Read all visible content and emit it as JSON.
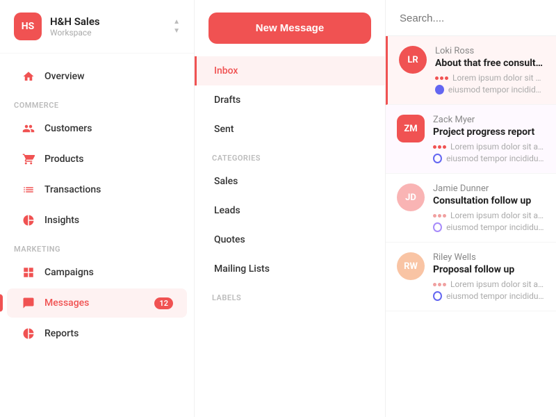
{
  "workspace": {
    "initials": "HS",
    "name": "H&H Sales",
    "subtitle": "Workspace"
  },
  "sidebar": {
    "overview_label": "Overview",
    "section_commerce": "Commerce",
    "section_marketing": "Marketing",
    "items": [
      {
        "id": "overview",
        "label": "Overview",
        "icon": "home",
        "active": false
      },
      {
        "id": "customers",
        "label": "Customers",
        "icon": "users",
        "active": false
      },
      {
        "id": "products",
        "label": "Products",
        "icon": "cart",
        "active": false
      },
      {
        "id": "transactions",
        "label": "Transactions",
        "icon": "list",
        "active": false
      },
      {
        "id": "insights",
        "label": "Insights",
        "icon": "pie",
        "active": false
      },
      {
        "id": "campaigns",
        "label": "Campaigns",
        "icon": "grid",
        "active": false
      },
      {
        "id": "messages",
        "label": "Messages",
        "icon": "chat",
        "active": true,
        "badge": "12"
      },
      {
        "id": "reports",
        "label": "Reports",
        "icon": "pie",
        "active": false
      }
    ]
  },
  "middle": {
    "new_message_label": "New Message",
    "nav_items": [
      {
        "id": "inbox",
        "label": "Inbox",
        "active": true
      },
      {
        "id": "drafts",
        "label": "Drafts",
        "active": false
      },
      {
        "id": "sent",
        "label": "Sent",
        "active": false
      }
    ],
    "section_categories": "Categories",
    "categories": [
      {
        "id": "sales",
        "label": "Sales"
      },
      {
        "id": "leads",
        "label": "Leads"
      },
      {
        "id": "quotes",
        "label": "Quotes"
      },
      {
        "id": "mailing-lists",
        "label": "Mailing Lists"
      }
    ],
    "section_labels": "Labels"
  },
  "right": {
    "search_placeholder": "Search....",
    "messages": [
      {
        "id": "msg1",
        "avatar_initials": "LR",
        "avatar_class": "avatar-lr",
        "sender": "Loki Ross",
        "subject": "About that free consultatio",
        "preview": "Lorem ipsum dolor sit amet, co",
        "preview2": "eiusmod tempor incididunt ut",
        "selected": true,
        "dots": [
          "#f05252",
          "#f05252",
          "#f05252"
        ],
        "tag_color": "#6366f1",
        "tag_border": "#6366f1"
      },
      {
        "id": "msg2",
        "avatar_initials": "ZM",
        "avatar_class": "avatar-zm",
        "sender": "Zack Myer",
        "subject": "Project progress report",
        "preview": "Lorem ipsum dolor sit amet, co",
        "preview2": "eiusmod tempor incididunt ut",
        "selected": false,
        "dots": [
          "#f05252",
          "#f05252",
          "#f05252"
        ],
        "tag_color": "#6366f1",
        "tag_border": "#6366f1"
      },
      {
        "id": "msg3",
        "avatar_initials": "JD",
        "avatar_class": "avatar-jd",
        "sender": "Jamie Dunner",
        "subject": "Consultation follow up",
        "preview": "Lorem ipsum dolor sit amet, co",
        "preview2": "eiusmod tempor incididunt ut",
        "selected": false,
        "dots": [
          "#f0a0a0",
          "#f0a0a0",
          "#f0a0a0"
        ],
        "tag_color": "#a78bfa",
        "tag_border": "#a78bfa"
      },
      {
        "id": "msg4",
        "avatar_initials": "RW",
        "avatar_class": "avatar-rw",
        "sender": "Riley Wells",
        "subject": "Proposal follow up",
        "preview": "Lorem ipsum dolor sit amet, co",
        "preview2": "eiusmod tempor incididunt ut",
        "selected": false,
        "dots": [
          "#f0a0a0",
          "#f0a0a0",
          "#f0a0a0"
        ],
        "tag_color": "#6366f1",
        "tag_border": "#6366f1"
      }
    ]
  }
}
